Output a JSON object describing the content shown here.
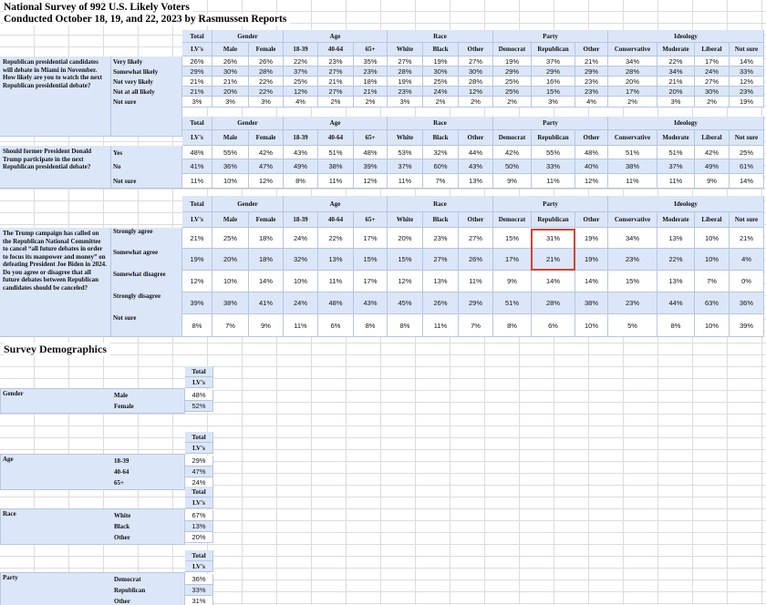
{
  "title_line1": "National Survey of 992 U.S. Likely Voters",
  "title_line2": "Conducted October 18, 19, and 22, 2023 by Rasmussen Reports",
  "groups": {
    "total": "Total",
    "gender": "Gender",
    "age": "Age",
    "race": "Race",
    "party": "Party",
    "ideology": "Ideology"
  },
  "columns": [
    "LV's",
    "Male",
    "Female",
    "18-39",
    "40-64",
    "65+",
    "White",
    "Black",
    "Other",
    "Democrat",
    "Republican",
    "Other",
    "Conservative",
    "Moderate",
    "Liberal",
    "Not sure"
  ],
  "questions": [
    {
      "text": "Republican presidential candidates will debate in Miami in November. How likely are you to watch the next Republican presidential debate?",
      "rows": [
        {
          "label": "Very likely",
          "values": [
            "26%",
            "26%",
            "26%",
            "22%",
            "23%",
            "35%",
            "27%",
            "19%",
            "27%",
            "19%",
            "37%",
            "21%",
            "34%",
            "22%",
            "17%",
            "14%"
          ]
        },
        {
          "label": "Somewhat likely",
          "values": [
            "29%",
            "30%",
            "28%",
            "37%",
            "27%",
            "23%",
            "28%",
            "30%",
            "30%",
            "29%",
            "29%",
            "29%",
            "28%",
            "34%",
            "24%",
            "33%"
          ]
        },
        {
          "label": "Not very likely",
          "values": [
            "21%",
            "21%",
            "22%",
            "25%",
            "21%",
            "18%",
            "19%",
            "25%",
            "28%",
            "25%",
            "16%",
            "23%",
            "20%",
            "21%",
            "27%",
            "12%"
          ]
        },
        {
          "label": "Not at all likely",
          "values": [
            "21%",
            "20%",
            "22%",
            "12%",
            "27%",
            "21%",
            "23%",
            "24%",
            "12%",
            "25%",
            "15%",
            "23%",
            "17%",
            "20%",
            "30%",
            "23%"
          ]
        },
        {
          "label": "Not sure",
          "values": [
            "3%",
            "3%",
            "3%",
            "4%",
            "2%",
            "2%",
            "3%",
            "2%",
            "2%",
            "2%",
            "3%",
            "4%",
            "2%",
            "3%",
            "2%",
            "19%"
          ]
        }
      ]
    },
    {
      "text": "Should former President Donald Trump participate in the next Republican presidential debate?",
      "rows": [
        {
          "label": "Yes",
          "values": [
            "48%",
            "55%",
            "42%",
            "43%",
            "51%",
            "48%",
            "53%",
            "32%",
            "44%",
            "42%",
            "55%",
            "48%",
            "51%",
            "51%",
            "42%",
            "25%"
          ]
        },
        {
          "label": "No",
          "values": [
            "41%",
            "36%",
            "47%",
            "49%",
            "38%",
            "39%",
            "37%",
            "60%",
            "43%",
            "50%",
            "33%",
            "40%",
            "38%",
            "37%",
            "49%",
            "61%"
          ]
        },
        {
          "label": "Not sure",
          "values": [
            "11%",
            "10%",
            "12%",
            "8%",
            "11%",
            "12%",
            "11%",
            "7%",
            "13%",
            "9%",
            "11%",
            "12%",
            "11%",
            "11%",
            "9%",
            "14%"
          ]
        }
      ]
    },
    {
      "text": "The Trump campaign has called on the Republican National Committee to cancel “all future debates in order to focus its manpower and money” on defeating President Joe Biden in 2024. Do you agree or disagree that all future debates between Republican candidates should be canceled?",
      "rows": [
        {
          "label": "Strongly agree",
          "values": [
            "21%",
            "25%",
            "18%",
            "24%",
            "22%",
            "17%",
            "20%",
            "23%",
            "27%",
            "15%",
            "31%",
            "19%",
            "34%",
            "13%",
            "10%",
            "21%"
          ]
        },
        {
          "label": "Somewhat agree",
          "values": [
            "19%",
            "20%",
            "18%",
            "32%",
            "13%",
            "15%",
            "15%",
            "27%",
            "26%",
            "17%",
            "21%",
            "19%",
            "23%",
            "22%",
            "10%",
            "4%"
          ]
        },
        {
          "label": "Somewhat disagree",
          "values": [
            "12%",
            "10%",
            "14%",
            "10%",
            "11%",
            "17%",
            "12%",
            "13%",
            "11%",
            "9%",
            "14%",
            "14%",
            "15%",
            "13%",
            "7%",
            "0%"
          ]
        },
        {
          "label": "Strongly disagree",
          "values": [
            "39%",
            "38%",
            "41%",
            "24%",
            "48%",
            "43%",
            "45%",
            "26%",
            "29%",
            "51%",
            "28%",
            "38%",
            "23%",
            "44%",
            "63%",
            "36%"
          ]
        },
        {
          "label": "Not sure",
          "values": [
            "8%",
            "7%",
            "9%",
            "11%",
            "6%",
            "8%",
            "8%",
            "11%",
            "7%",
            "8%",
            "6%",
            "10%",
            "5%",
            "8%",
            "10%",
            "39%"
          ]
        }
      ]
    }
  ],
  "demographics": {
    "heading": "Survey Demographics",
    "total_label": "Total",
    "lv_label": "LV's",
    "sections": [
      {
        "name": "Gender",
        "rows": [
          {
            "label": "Male",
            "value": "48%"
          },
          {
            "label": "Female",
            "value": "52%"
          }
        ]
      },
      {
        "name": "Age",
        "rows": [
          {
            "label": "18-39",
            "value": "29%"
          },
          {
            "label": "40-64",
            "value": "47%"
          },
          {
            "label": "65+",
            "value": "24%"
          }
        ]
      },
      {
        "name": "Race",
        "rows": [
          {
            "label": "White",
            "value": "67%"
          },
          {
            "label": "Black",
            "value": "13%"
          },
          {
            "label": "Other",
            "value": "20%"
          }
        ]
      },
      {
        "name": "Party",
        "rows": [
          {
            "label": "Democrat",
            "value": "36%"
          },
          {
            "label": "Republican",
            "value": "33%"
          },
          {
            "label": "Other",
            "value": "31%"
          }
        ]
      }
    ]
  },
  "colors": {
    "header_blue": "#dbe6f8",
    "highlight_red": "#d9412e"
  }
}
